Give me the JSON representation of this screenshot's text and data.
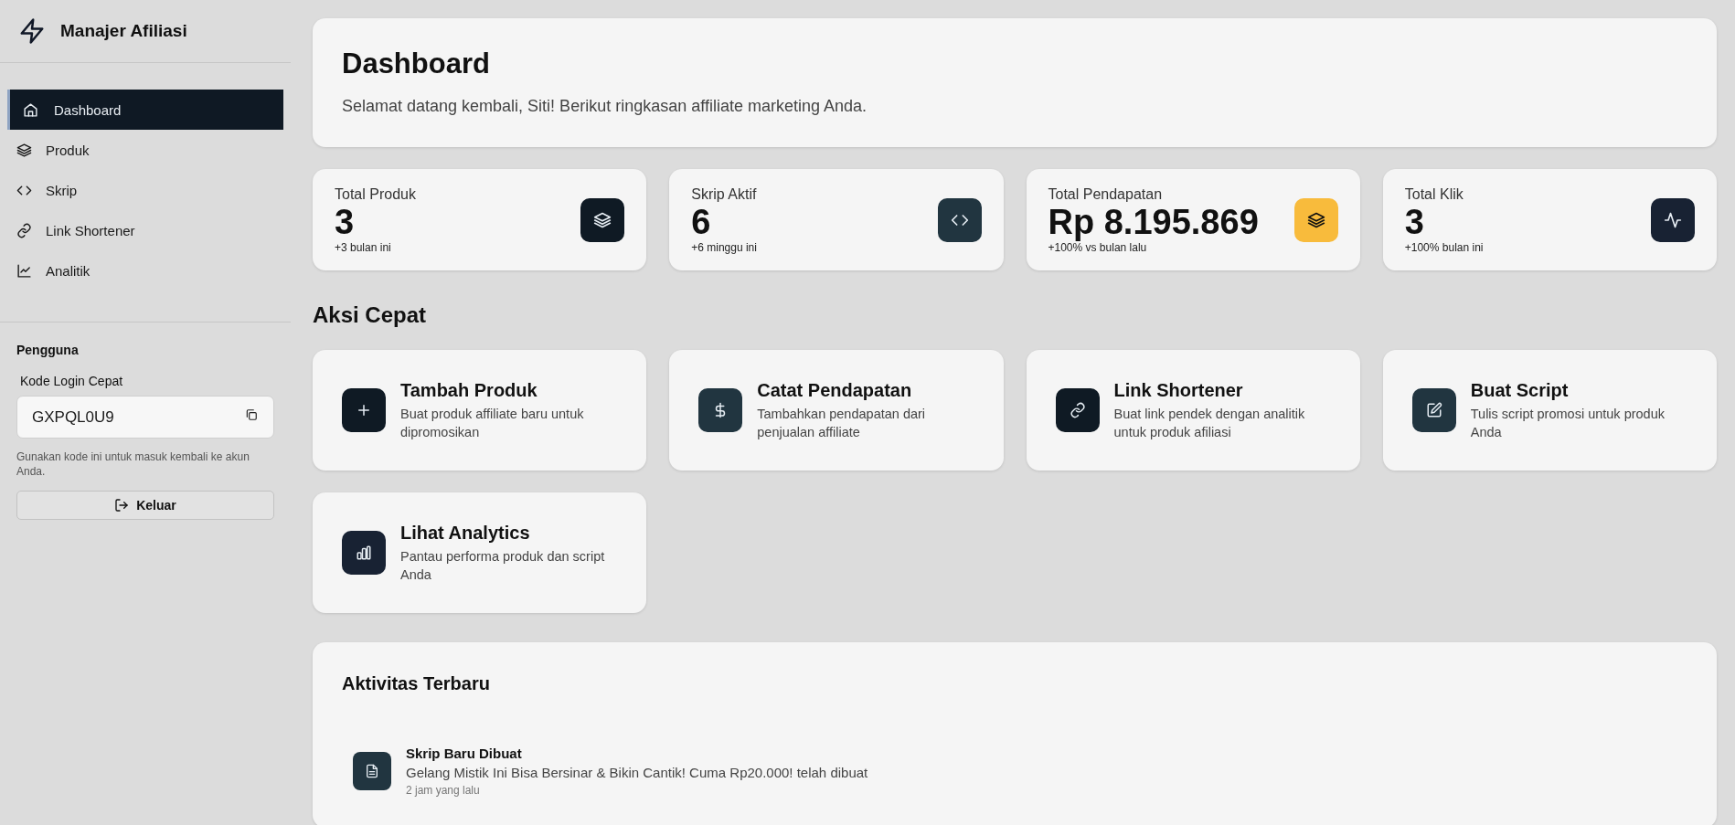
{
  "app": {
    "title": "Manajer Afiliasi"
  },
  "sidebar": {
    "items": [
      {
        "label": "Dashboard",
        "selected": true
      },
      {
        "label": "Produk",
        "selected": false
      },
      {
        "label": "Skrip",
        "selected": false
      },
      {
        "label": "Link Shortener",
        "selected": false
      },
      {
        "label": "Analitik",
        "selected": false
      }
    ],
    "user": {
      "heading": "Pengguna",
      "code_label": "Kode Login Cepat",
      "code_value": "GXPQL0U9",
      "hint": "Gunakan kode ini untuk masuk kembali ke akun Anda.",
      "logout_button": "Keluar"
    }
  },
  "header": {
    "title": "Dashboard",
    "subtitle": "Selamat datang kembali, Siti! Berikut ringkasan affiliate marketing Anda."
  },
  "stats": [
    {
      "label": "Total Produk",
      "value": "3",
      "note": "+3 bulan ini",
      "color": "#0f1a24"
    },
    {
      "label": "Skrip Aktif",
      "value": "6",
      "note": "+6 minggu ini",
      "color": "#213540"
    },
    {
      "label": "Total Pendapatan",
      "value": "Rp 8.195.869",
      "note": "+100% vs bulan lalu",
      "color": "#f8bb3c"
    },
    {
      "label": "Total Klik",
      "value": "3",
      "note": "+100% bulan ini",
      "color": "#182233"
    }
  ],
  "quick_actions": {
    "title": "Aksi Cepat",
    "items": [
      {
        "title": "Tambah Produk",
        "description": "Buat produk affiliate baru untuk dipromosikan",
        "color": "#0f1a24"
      },
      {
        "title": "Catat Pendapatan",
        "description": "Tambahkan pendapatan dari penjualan affiliate",
        "color": "#213540"
      },
      {
        "title": "Link Shortener",
        "description": "Buat link pendek dengan analitik untuk produk afiliasi",
        "color": "#0f1a24"
      },
      {
        "title": "Buat Script",
        "description": "Tulis script promosi untuk produk Anda",
        "color": "#213540"
      },
      {
        "title": "Lihat Analytics",
        "description": "Pantau performa produk dan script Anda",
        "color": "#182233"
      }
    ]
  },
  "recent_activity": {
    "title": "Aktivitas Terbaru",
    "items": [
      {
        "title": "Skrip Baru Dibuat",
        "description": "Gelang Mistik Ini Bisa Bersinar & Bikin Cantik! Cuma Rp20.000! telah dibuat",
        "time": "2 jam yang lalu",
        "color": "#213540"
      }
    ]
  }
}
